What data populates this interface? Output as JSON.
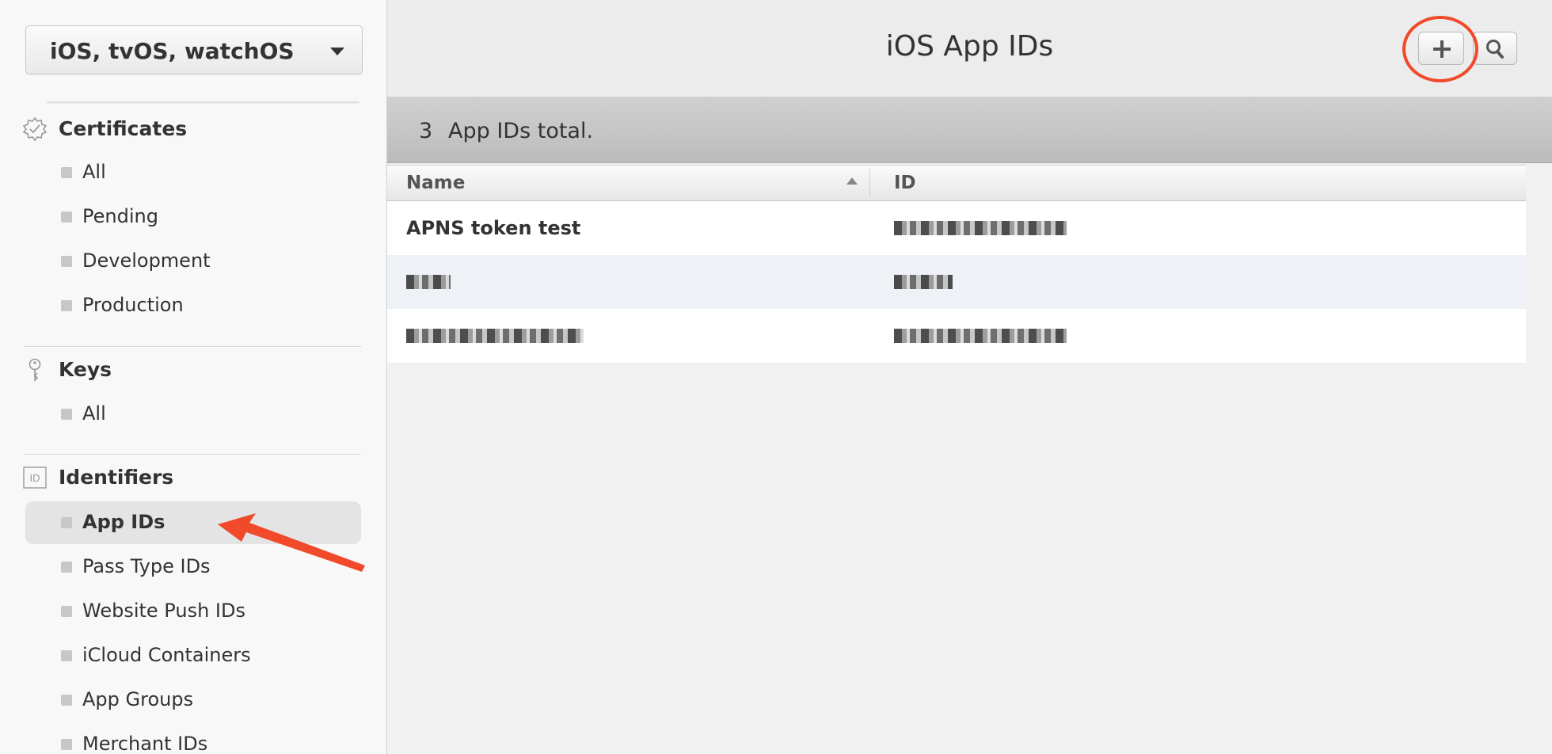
{
  "sidebar": {
    "platform": "iOS, tvOS, watchOS",
    "sections": [
      {
        "label": "Certificates",
        "icon": "certificate-badge-icon"
      },
      {
        "label": "Keys",
        "icon": "key-icon"
      },
      {
        "label": "Identifiers",
        "icon": "id-icon",
        "icon_text": "ID"
      }
    ],
    "certificates": [
      "All",
      "Pending",
      "Development",
      "Production"
    ],
    "keys": [
      "All"
    ],
    "identifiers": [
      "App IDs",
      "Pass Type IDs",
      "Website Push IDs",
      "iCloud Containers",
      "App Groups",
      "Merchant IDs"
    ],
    "selected": "App IDs"
  },
  "header": {
    "title": "iOS App IDs",
    "add_icon": "plus-icon",
    "search_icon": "search-icon"
  },
  "summary": {
    "count": "3",
    "label": "App IDs total."
  },
  "table": {
    "columns": [
      "Name",
      "ID"
    ],
    "sort_column": "Name",
    "sort_direction": "ascending",
    "rows": [
      {
        "name": "APNS token test",
        "id": "",
        "redacted": [
          "id"
        ]
      },
      {
        "name": "",
        "id": "",
        "redacted": [
          "name",
          "id"
        ]
      },
      {
        "name": "",
        "id": "",
        "redacted": [
          "name",
          "id"
        ]
      }
    ]
  },
  "annotations": {
    "highlight_color": "#f04a2a"
  }
}
